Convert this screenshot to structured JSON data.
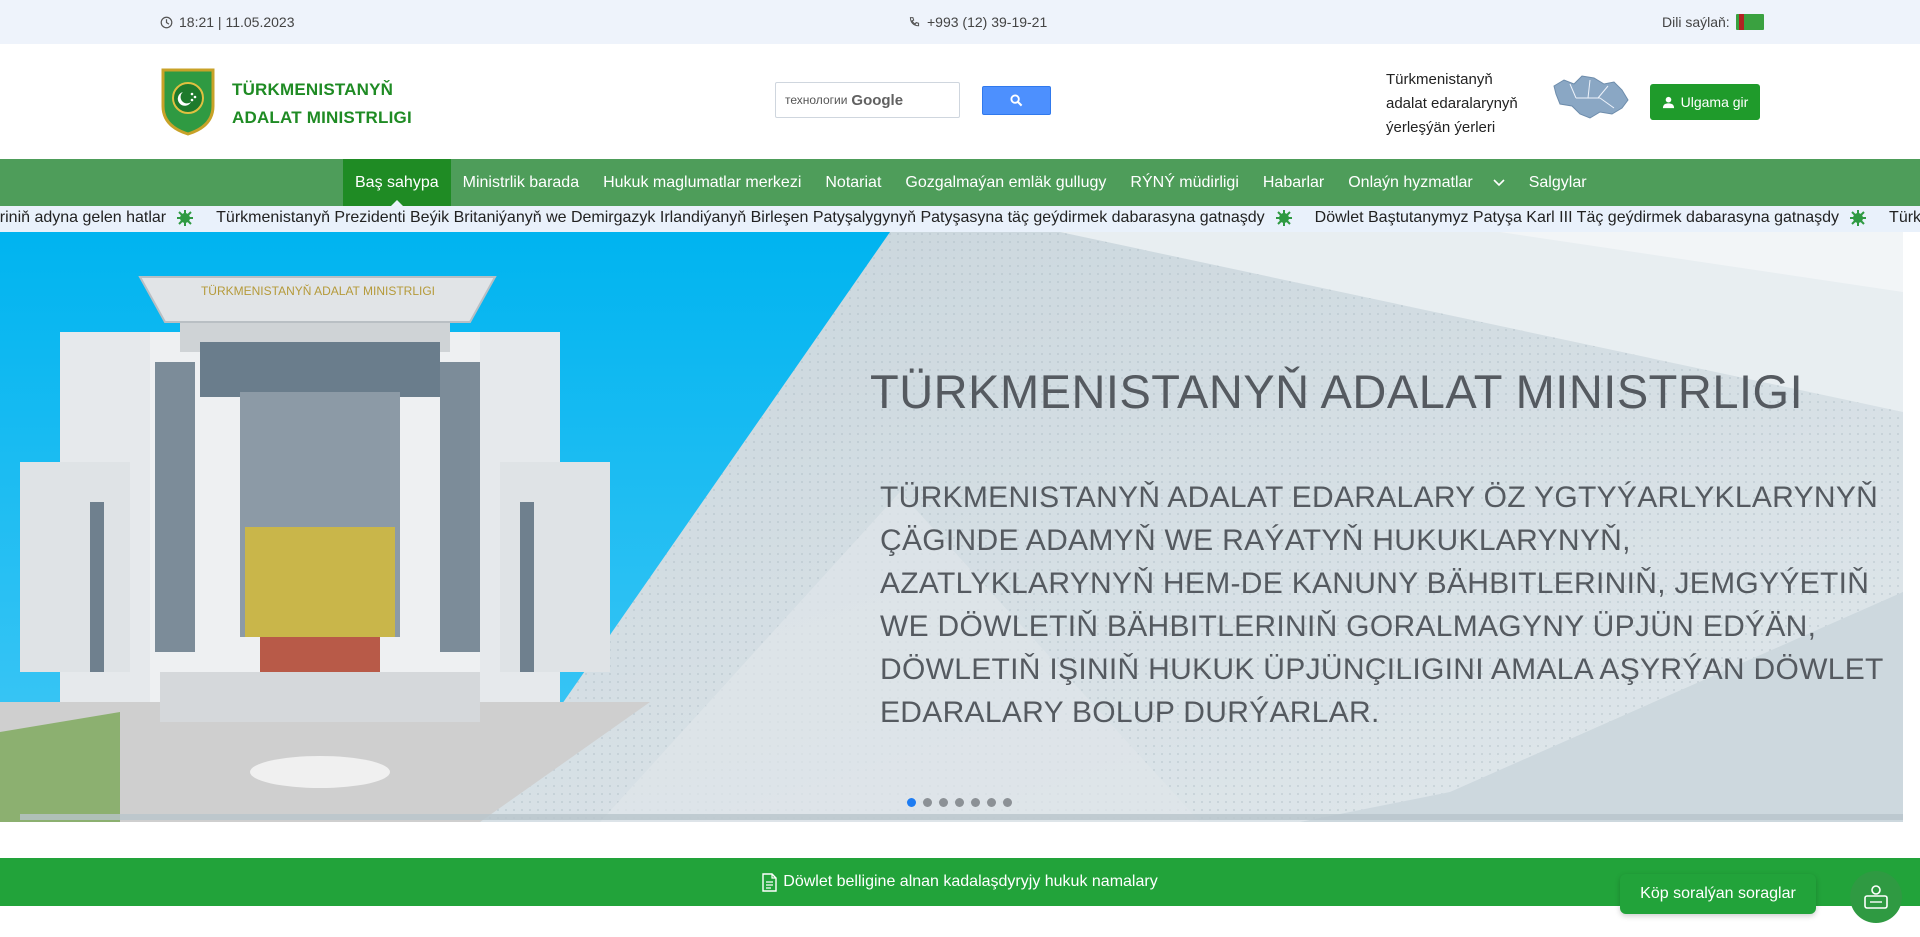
{
  "topbar": {
    "datetime": "18:21 | 11.05.2023",
    "phone": "+993 (12) 39-19-21",
    "language_label": "Dili saýlaň:"
  },
  "header": {
    "brand_line1": "TÜRKMENISTANYŇ",
    "brand_line2": "ADALAT MINISTRLIGI",
    "search_placeholder": "технологии",
    "search_brand": "Google",
    "locations_text": "Türkmenistanyň adalat edaralarynyň ýerleşýän ýerleri",
    "login_label": "Ulgama gir"
  },
  "nav": {
    "items": [
      {
        "label": "Baş sahypa",
        "active": true
      },
      {
        "label": "Ministrlik barada"
      },
      {
        "label": "Hukuk maglumatlar merkezi"
      },
      {
        "label": "Notariat"
      },
      {
        "label": "Gozgalmaýan emläk gullugy"
      },
      {
        "label": "RÝNÝ müdirligi"
      },
      {
        "label": "Habarlar"
      },
      {
        "label": "Onlaýn hyzmatlar"
      },
      {
        "label": "Salgylar"
      }
    ]
  },
  "ticker": {
    "items": [
      "deriniň adyna gelen hatlar",
      "Türkmenistanyň Prezidenti Beýik Britaniýanyň we Demirgazyk Irlandiýanyň Birleşen Patyşalygynyň Patyşasyna täç geýdirmek dabarasyna gatnaşdy",
      "Döwlet Baştutanymyz Patyşa Karl III Täç geýdirmek dabarasyna gatnaşdy",
      "Türkmenist"
    ]
  },
  "slider": {
    "building_sign": "TÜRKMENISTANYŇ ADALAT MINISTRLIGI",
    "title": "TÜRKMENISTANYŇ ADALAT MINISTRLIGI",
    "body": "TÜRKMENISTANYŇ ADALAT EDARALARY ÖZ YGTYÝARLYKLARYNYŇ ÇÄGINDE ADAMYŇ WE RAÝATYŇ HUKUKLARYNYŇ, AZATLYKLARYNYŇ HEM-DE KANUNY BÄHBITLERINIŇ, JEMGYÝETIŇ WE DÖWLETIŇ  BÄHBITLERINIŇ  GORALMAGYNY ÜPJÜN EDÝÄN, DÖWLETIŇ IŞINIŇ HUKUK ÜPJÜNÇILIGINI AMALA AŞYRÝAN DÖWLET EDARALARY BOLUP DURÝARLAR.",
    "slide_count": 7,
    "active_slide": 1
  },
  "doc_bar_label": "Döwlet belligine alnan kadalaşdyryjy hukuk namalary",
  "faq_label": "Köp soralýan soraglar",
  "colors": {
    "nav": "#4e9d5a",
    "nav_active": "#1f8b24",
    "brand_green": "#1f8b24",
    "cta_green": "#22a33a"
  }
}
